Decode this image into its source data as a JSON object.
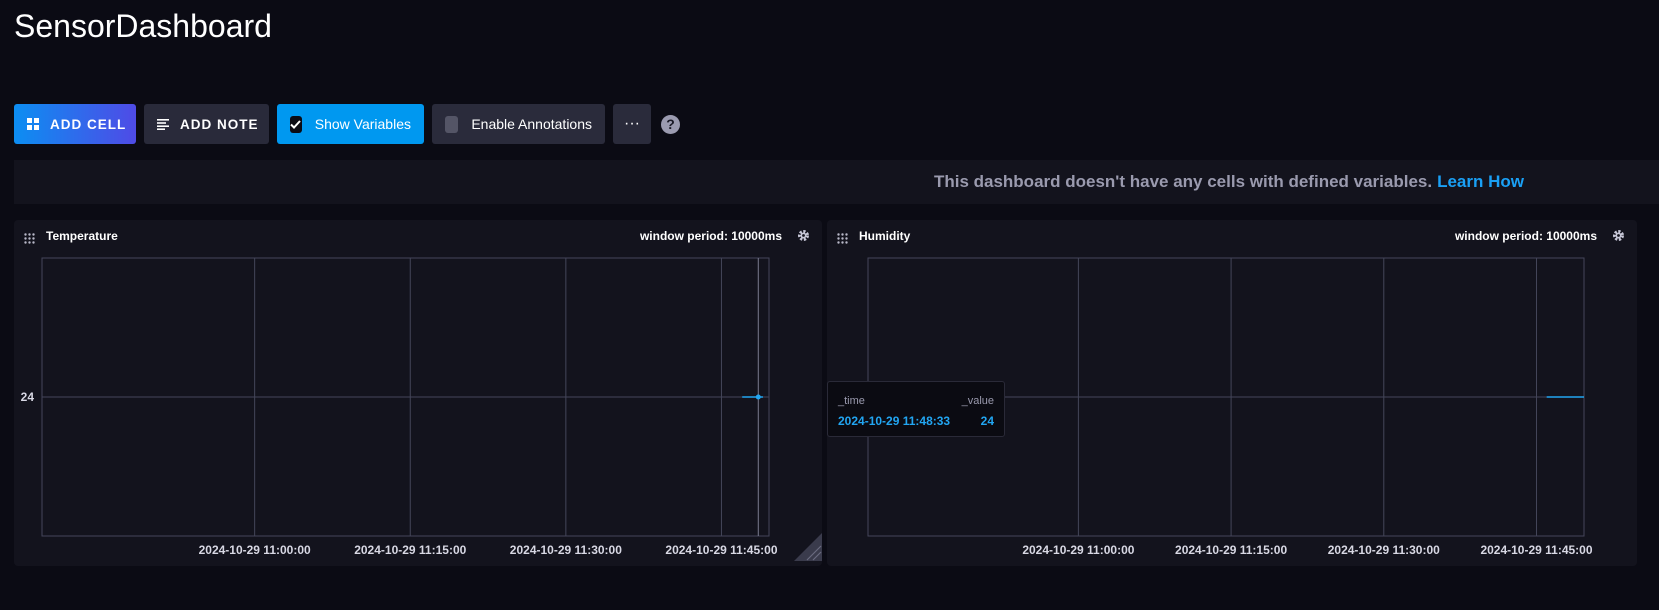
{
  "page": {
    "title": "SensorDashboard"
  },
  "toolbar": {
    "add_cell": "ADD CELL",
    "add_note": "ADD NOTE",
    "show_variables": "Show Variables",
    "enable_annotations": "Enable Annotations",
    "more": "···",
    "help": "?"
  },
  "variables_bar": {
    "message": "This dashboard doesn't have any cells with defined variables.",
    "link": "Learn How"
  },
  "cells": {
    "temperature": {
      "name": "Temperature",
      "window": "window period: 10000ms"
    },
    "humidity": {
      "name": "Humidity",
      "window": "window period: 10000ms"
    }
  },
  "tooltip": {
    "time_header": "_time",
    "value_header": "_value",
    "time": "2024-10-29 11:48:33",
    "value": "24"
  },
  "colors": {
    "accent": "#0098f0",
    "series": "#22a6f2",
    "gridline": "#44465a"
  },
  "chart_data": [
    {
      "type": "line",
      "title": "Temperature",
      "y_ticks": [
        "24"
      ],
      "x_ticks": [
        "2024-10-29 11:00:00",
        "2024-10-29 11:15:00",
        "2024-10-29 11:30:00",
        "2024-10-29 11:45:00"
      ],
      "series": [
        {
          "x": [
            "2024-10-29 11:47:00",
            "2024-10-29 11:48:33",
            "2024-10-29 11:49:00"
          ],
          "values": [
            24,
            24,
            24
          ]
        }
      ],
      "hover_time": "2024-10-29 11:48:33"
    },
    {
      "type": "line",
      "title": "Humidity",
      "y_ticks": [],
      "x_ticks": [
        "2024-10-29 11:00:00",
        "2024-10-29 11:15:00",
        "2024-10-29 11:30:00",
        "2024-10-29 11:45:00"
      ],
      "series": [
        {
          "x": [
            "2024-10-29 11:46:00",
            "2024-10-29 11:49:40"
          ],
          "values": [
            24,
            24
          ]
        }
      ]
    }
  ]
}
